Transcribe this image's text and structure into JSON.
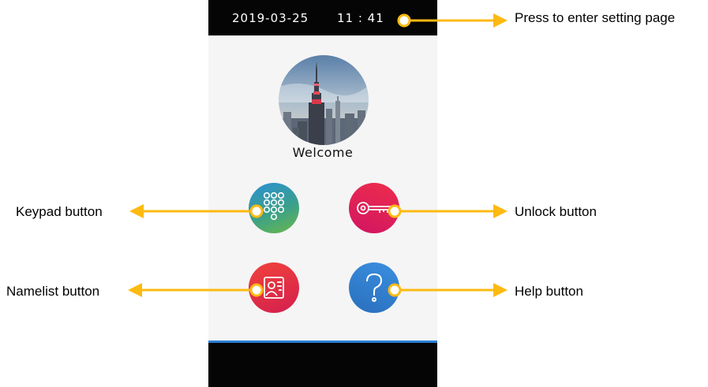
{
  "status_bar": {
    "date": "2019-03-25",
    "time": "11 : 41"
  },
  "screen": {
    "welcome_text": "Welcome",
    "photo": "city-skyline-photo"
  },
  "buttons": {
    "keypad": {
      "icon": "keypad-icon"
    },
    "unlock": {
      "icon": "key-icon"
    },
    "namelist": {
      "icon": "contact-card-icon"
    },
    "help": {
      "icon": "question-mark-icon"
    }
  },
  "callouts": {
    "settings": "Press to enter setting page",
    "keypad": "Keypad button",
    "unlock": "Unlock button",
    "namelist": "Namelist button",
    "help": "Help button"
  },
  "colors": {
    "arrow": "#FDBA12",
    "accent_line": "#2B7FD6"
  }
}
